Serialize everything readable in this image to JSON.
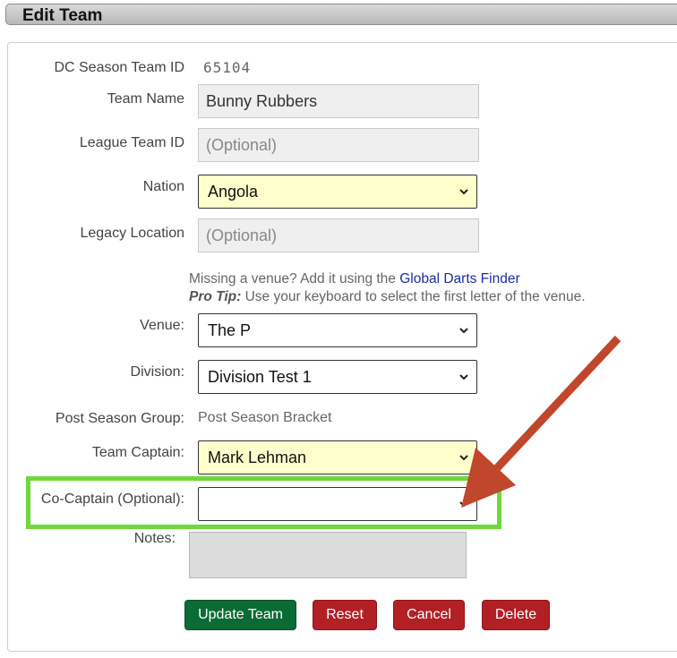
{
  "header": {
    "title": "Edit Team"
  },
  "form": {
    "season_team_id_label": "DC Season Team ID",
    "season_team_id_value": "65104",
    "team_name_label": "Team Name",
    "team_name_value": "Bunny Rubbers",
    "league_team_id_label": "League Team ID",
    "league_team_id_placeholder": "(Optional)",
    "nation_label": "Nation",
    "nation_value": "Angola",
    "legacy_location_label": "Legacy Location",
    "legacy_location_placeholder": "(Optional)",
    "info_line1_text": "Missing a venue? Add it using the ",
    "info_line1_link": "Global Darts Finder",
    "info_line2_bold": "Pro Tip:",
    "info_line2_text": " Use your keyboard to select the first letter of the venue.",
    "venue_label": "Venue:",
    "venue_value": "The P",
    "division_label": "Division:",
    "division_value": "Division Test 1",
    "post_season_group_label": "Post Season Group:",
    "post_season_group_value": "Post Season Bracket",
    "team_captain_label": "Team Captain:",
    "team_captain_value": "Mark Lehman",
    "co_captain_label": "Co-Captain (Optional):",
    "co_captain_value": "",
    "notes_label": "Notes:"
  },
  "buttons": {
    "update": "Update Team",
    "reset": "Reset",
    "cancel": "Cancel",
    "delete": "Delete"
  },
  "colors": {
    "highlight_box": "#6ed83c",
    "arrow": "#c0472c",
    "primary_button": "#0b6b35",
    "danger_button": "#b22025",
    "required_select": "#ffffcc"
  },
  "icons": {
    "select_arrow": "chevron-down-icon"
  }
}
